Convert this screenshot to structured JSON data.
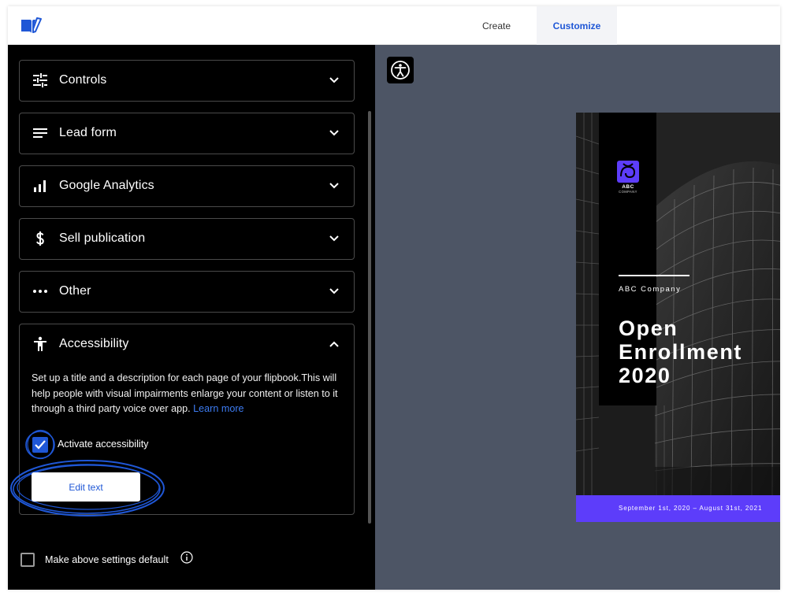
{
  "header": {
    "logo_icon": "book-pen-icon",
    "tabs": [
      {
        "label": "Create",
        "active": false
      },
      {
        "label": "Customize",
        "active": true
      }
    ]
  },
  "sidebar": {
    "panels": [
      {
        "title": "Controls",
        "icon": "sliders-icon",
        "expanded": false
      },
      {
        "title": "Lead form",
        "icon": "lines-icon",
        "expanded": false
      },
      {
        "title": "Google Analytics",
        "icon": "bar-chart-icon",
        "expanded": false
      },
      {
        "title": "Sell publication",
        "icon": "dollar-icon",
        "expanded": false
      },
      {
        "title": "Other",
        "icon": "more-dots-icon",
        "expanded": false
      },
      {
        "title": "Accessibility",
        "icon": "person-icon",
        "expanded": true
      }
    ],
    "accessibility": {
      "description": "Set up a title and a description for each page of your flipbook.This will help people with visual impairments enlarge your content or listen to it through a third party voice over app.",
      "learn_more": "Learn more",
      "checkbox_label": "Activate accessibility",
      "checkbox_checked": true,
      "edit_button": "Edit text"
    },
    "default_label": "Make above settings default",
    "default_checked": false
  },
  "preview": {
    "accessibility_icon": "accessibility-icon",
    "cover": {
      "logo_abc": "ABC",
      "logo_company": "COMPANY",
      "company": "ABC Company",
      "title_lines": [
        "Open",
        "Enrollment",
        "2020"
      ],
      "dates": "September 1st, 2020 – August 31st, 2021"
    }
  },
  "colors": {
    "accent": "#1f57d6",
    "link": "#3d7cf2",
    "cover_footer": "#5d3dfa",
    "cover_logo": "#5d3dfa",
    "preview_bg": "#4d5565",
    "sidebar_bg": "#000000"
  }
}
